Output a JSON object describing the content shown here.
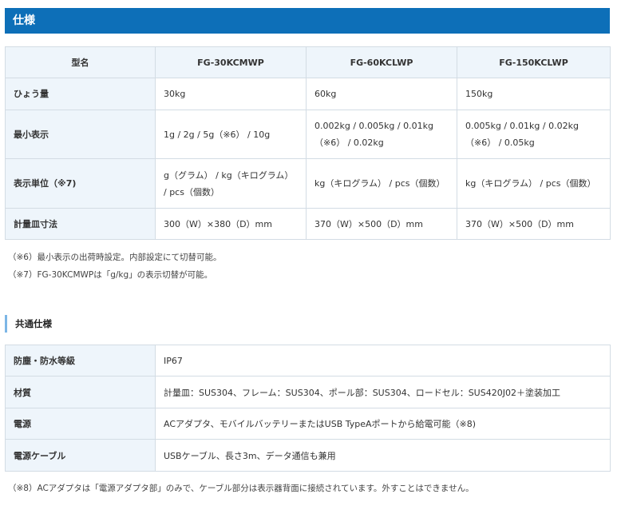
{
  "section_title": "仕様",
  "spec_table": {
    "header": [
      "型名",
      "FG-30KCMWP",
      "FG-60KCLWP",
      "FG-150KCLWP"
    ],
    "rows": [
      {
        "label": "ひょう量",
        "cells": [
          "30kg",
          "60kg",
          "150kg"
        ]
      },
      {
        "label": "最小表示",
        "cells": [
          "1g / 2g / 5g（※6） / 10g",
          "0.002kg / 0.005kg / 0.01kg （※6） / 0.02kg",
          "0.005kg / 0.01kg / 0.02kg（※6） / 0.05kg"
        ]
      },
      {
        "label": "表示単位（※7)",
        "cells": [
          "g（グラム） / kg（キログラム） / pcs（個数）",
          "kg（キログラム） / pcs（個数）",
          "kg（キログラム） / pcs（個数）"
        ]
      },
      {
        "label": "計量皿寸法",
        "cells": [
          "300（W）×380（D）mm",
          "370（W）×500（D）mm",
          "370（W）×500（D）mm"
        ]
      }
    ]
  },
  "notes": [
    "（※6）最小表示の出荷時設定。内部設定にて切替可能。",
    "（※7）FG-30KCMWPは「g/kg」の表示切替が可能。"
  ],
  "common_heading": "共通仕様",
  "common_table": {
    "rows": [
      {
        "label": "防塵・防水等級",
        "value": "IP67"
      },
      {
        "label": "材質",
        "value": "計量皿：SUS304、フレーム：SUS304、ポール部：SUS304、ロードセル：SUS420J02＋塗装加工"
      },
      {
        "label": "電源",
        "value": "ACアダプタ、モバイルバッテリーまたはUSB TypeAポートから給電可能（※8)"
      },
      {
        "label": "電源ケーブル",
        "value": "USBケーブル、長さ3m、データ通信も兼用"
      }
    ]
  },
  "footnote": "（※8）ACアダプタは「電源アダプタ部」のみで、ケーブル部分は表示器背面に接続されています。外すことはできません。",
  "colors": {
    "header_bar": "#0d6fb8",
    "row_head_bg": "#eef5fb",
    "border": "#d3dce4",
    "sub_heading_accent": "#7cb6e6"
  }
}
